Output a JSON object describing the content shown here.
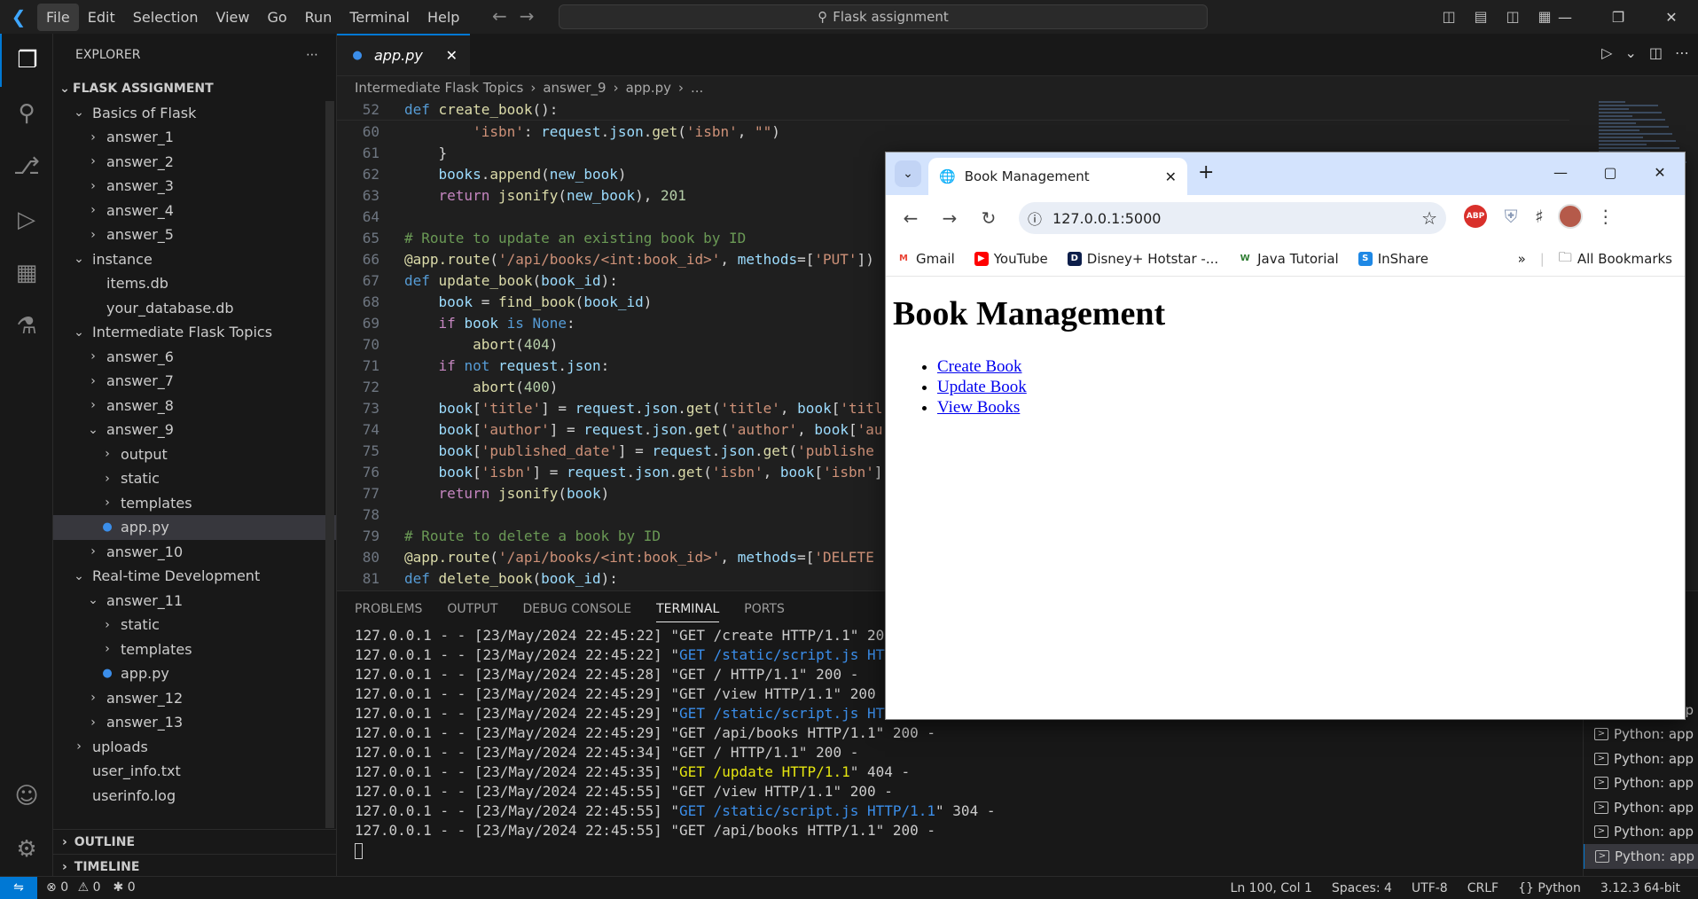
{
  "menu": [
    "File",
    "Edit",
    "Selection",
    "View",
    "Go",
    "Run",
    "Terminal",
    "Help"
  ],
  "command_center": "Flask assignment",
  "sidebar": {
    "header": "EXPLORER",
    "project": "FLASK ASSIGNMENT",
    "tree": [
      {
        "label": "Basics of Flask",
        "indent": 1,
        "chev": "v"
      },
      {
        "label": "answer_1",
        "indent": 2,
        "chev": ">"
      },
      {
        "label": "answer_2",
        "indent": 2,
        "chev": ">"
      },
      {
        "label": "answer_3",
        "indent": 2,
        "chev": ">"
      },
      {
        "label": "answer_4",
        "indent": 2,
        "chev": ">"
      },
      {
        "label": "answer_5",
        "indent": 2,
        "chev": ">"
      },
      {
        "label": "instance",
        "indent": 1,
        "chev": "v"
      },
      {
        "label": "items.db",
        "indent": 2,
        "chev": ""
      },
      {
        "label": "your_database.db",
        "indent": 2,
        "chev": ""
      },
      {
        "label": "Intermediate Flask Topics",
        "indent": 1,
        "chev": "v"
      },
      {
        "label": "answer_6",
        "indent": 2,
        "chev": ">"
      },
      {
        "label": "answer_7",
        "indent": 2,
        "chev": ">"
      },
      {
        "label": "answer_8",
        "indent": 2,
        "chev": ">"
      },
      {
        "label": "answer_9",
        "indent": 2,
        "chev": "v"
      },
      {
        "label": "output",
        "indent": 3,
        "chev": ">"
      },
      {
        "label": "static",
        "indent": 3,
        "chev": ">"
      },
      {
        "label": "templates",
        "indent": 3,
        "chev": ">"
      },
      {
        "label": "app.py",
        "indent": 3,
        "chev": "py",
        "selected": true
      },
      {
        "label": "answer_10",
        "indent": 2,
        "chev": ">"
      },
      {
        "label": "Real-time Development",
        "indent": 1,
        "chev": "v"
      },
      {
        "label": "answer_11",
        "indent": 2,
        "chev": "v"
      },
      {
        "label": "static",
        "indent": 3,
        "chev": ">"
      },
      {
        "label": "templates",
        "indent": 3,
        "chev": ">"
      },
      {
        "label": "app.py",
        "indent": 3,
        "chev": "py"
      },
      {
        "label": "answer_12",
        "indent": 2,
        "chev": ">"
      },
      {
        "label": "answer_13",
        "indent": 2,
        "chev": ">"
      },
      {
        "label": "uploads",
        "indent": 1,
        "chev": ">"
      },
      {
        "label": "user_info.txt",
        "indent": 1,
        "chev": ""
      },
      {
        "label": "userinfo.log",
        "indent": 1,
        "chev": ""
      }
    ],
    "outline": "OUTLINE",
    "timeline": "TIMELINE"
  },
  "editor": {
    "tab": "app.py",
    "breadcrumb": [
      "Intermediate Flask Topics",
      "answer_9",
      "app.py",
      "..."
    ],
    "lines": [
      {
        "n": "52",
        "html": "<span class='kw'>def</span> <span class='fn'>create_book</span>():",
        "sticky": true
      },
      {
        "n": "60",
        "html": "        <span class='str'>'isbn'</span>: <span class='var'>request</span>.<span class='var'>json</span>.<span class='fn'>get</span>(<span class='str'>'isbn'</span>, <span class='str'>\"\"</span>)"
      },
      {
        "n": "61",
        "html": "    }"
      },
      {
        "n": "62",
        "html": "    <span class='var'>books</span>.<span class='fn'>append</span>(<span class='var'>new_book</span>)"
      },
      {
        "n": "63",
        "html": "    <span class='kw2'>return</span> <span class='fn'>jsonify</span>(<span class='var'>new_book</span>), <span class='num'>201</span>"
      },
      {
        "n": "64",
        "html": ""
      },
      {
        "n": "65",
        "html": "<span class='cm'># Route to update an existing book by ID</span>"
      },
      {
        "n": "66",
        "html": "<span class='fn'>@app.route</span>(<span class='str'>'/api/books/&lt;int:book_id&gt;'</span>, <span class='var'>methods</span>=[<span class='str'>'PUT'</span>])"
      },
      {
        "n": "67",
        "html": "<span class='kw'>def</span> <span class='fn'>update_book</span>(<span class='var'>book_id</span>):"
      },
      {
        "n": "68",
        "html": "    <span class='var'>book</span> = <span class='fn'>find_book</span>(<span class='var'>book_id</span>)"
      },
      {
        "n": "69",
        "html": "    <span class='kw2'>if</span> <span class='var'>book</span> <span class='kw'>is</span> <span class='kw'>None</span>:"
      },
      {
        "n": "70",
        "html": "        <span class='fn'>abort</span>(<span class='num'>404</span>)"
      },
      {
        "n": "71",
        "html": "    <span class='kw2'>if</span> <span class='kw'>not</span> <span class='var'>request</span>.<span class='var'>json</span>:"
      },
      {
        "n": "72",
        "html": "        <span class='fn'>abort</span>(<span class='num'>400</span>)"
      },
      {
        "n": "73",
        "html": "    <span class='var'>book</span>[<span class='str'>'title'</span>] = <span class='var'>request</span>.<span class='var'>json</span>.<span class='fn'>get</span>(<span class='str'>'title'</span>, <span class='var'>book</span>[<span class='str'>'titl</span>"
      },
      {
        "n": "74",
        "html": "    <span class='var'>book</span>[<span class='str'>'author'</span>] = <span class='var'>request</span>.<span class='var'>json</span>.<span class='fn'>get</span>(<span class='str'>'author'</span>, <span class='var'>book</span>[<span class='str'>'au</span>"
      },
      {
        "n": "75",
        "html": "    <span class='var'>book</span>[<span class='str'>'published_date'</span>] = <span class='var'>request</span>.<span class='var'>json</span>.<span class='fn'>get</span>(<span class='str'>'publishe</span>"
      },
      {
        "n": "76",
        "html": "    <span class='var'>book</span>[<span class='str'>'isbn'</span>] = <span class='var'>request</span>.<span class='var'>json</span>.<span class='fn'>get</span>(<span class='str'>'isbn'</span>, <span class='var'>book</span>[<span class='str'>'isbn'</span>]"
      },
      {
        "n": "77",
        "html": "    <span class='kw2'>return</span> <span class='fn'>jsonify</span>(<span class='var'>book</span>)"
      },
      {
        "n": "78",
        "html": ""
      },
      {
        "n": "79",
        "html": "<span class='cm'># Route to delete a book by ID</span>"
      },
      {
        "n": "80",
        "html": "<span class='fn'>@app.route</span>(<span class='str'>'/api/books/&lt;int:book_id&gt;'</span>, <span class='var'>methods</span>=[<span class='str'>'DELETE</span>"
      },
      {
        "n": "81",
        "html": "<span class='kw'>def</span> <span class='fn'>delete_book</span>(<span class='var'>book_id</span>):"
      }
    ]
  },
  "panel": {
    "tabs": [
      "PROBLEMS",
      "OUTPUT",
      "DEBUG CONSOLE",
      "TERMINAL",
      "PORTS"
    ],
    "active_tab": "TERMINAL",
    "terminal": [
      {
        "html": "127.0.0.1 - - [23/May/2024 22:45:22] \"GET /create HTTP/1.1\" 200 -"
      },
      {
        "html": "127.0.0.1 - - [23/May/2024 22:45:22] \"<span class='term-blue'>GET /static/script.js HTTP/1.1</span>\" 304 -"
      },
      {
        "html": "127.0.0.1 - - [23/May/2024 22:45:28] \"GET / HTTP/1.1\" 200 -"
      },
      {
        "html": "127.0.0.1 - - [23/May/2024 22:45:29] \"GET /view HTTP/1.1\" 200 -"
      },
      {
        "html": "127.0.0.1 - - [23/May/2024 22:45:29] \"<span class='term-blue'>GET /static/script.js HTTP/1.1</span>\" 304 -"
      },
      {
        "html": "127.0.0.1 - - [23/May/2024 22:45:29] \"GET /api/books HTTP/1.1\" 200 -"
      },
      {
        "html": "127.0.0.1 - - [23/May/2024 22:45:34] \"GET / HTTP/1.1\" 200 -"
      },
      {
        "html": "127.0.0.1 - - [23/May/2024 22:45:35] \"<span class='term-yellow'>GET /update HTTP/1.1</span>\" 404 -"
      },
      {
        "html": "127.0.0.1 - - [23/May/2024 22:45:55] \"GET /view HTTP/1.1\" 200 -"
      },
      {
        "html": "127.0.0.1 - - [23/May/2024 22:45:55] \"<span class='term-blue'>GET /static/script.js HTTP/1.1</span>\" 304 -"
      },
      {
        "html": "127.0.0.1 - - [23/May/2024 22:45:55] \"GET /api/books HTTP/1.1\" 200 -"
      }
    ],
    "terminal_list": [
      "Python: app",
      "Python: app",
      "Python: app",
      "Python: app",
      "Python: app",
      "Python: app",
      "Python: app"
    ]
  },
  "status": {
    "errors": "0",
    "warnings": "0",
    "ports": "0",
    "position": "Ln 100, Col 1",
    "spaces": "Spaces: 4",
    "encoding": "UTF-8",
    "eol": "CRLF",
    "language": "Python",
    "interpreter": "3.12.3 64-bit"
  },
  "browser": {
    "tab_title": "Book Management",
    "url": "127.0.0.1:5000",
    "bookmarks": [
      "Gmail",
      "YouTube",
      "Disney+ Hotstar -...",
      "Java Tutorial",
      "InShare"
    ],
    "all_bookmarks": "All Bookmarks",
    "abp": "ABP",
    "page": {
      "heading": "Book Management",
      "links": [
        "Create Book",
        "Update Book",
        "View Books"
      ]
    }
  }
}
